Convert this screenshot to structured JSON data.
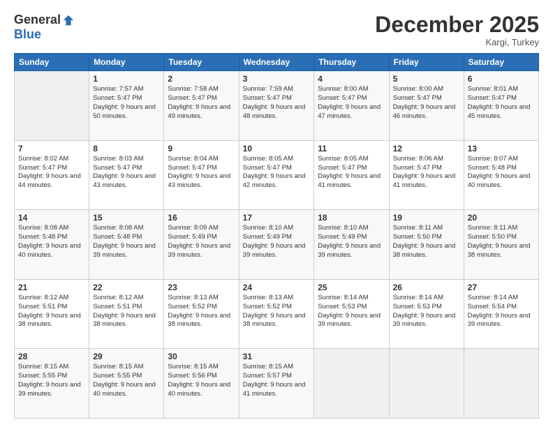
{
  "logo": {
    "general": "General",
    "blue": "Blue"
  },
  "header": {
    "month": "December 2025",
    "location": "Kargi, Turkey"
  },
  "weekdays": [
    "Sunday",
    "Monday",
    "Tuesday",
    "Wednesday",
    "Thursday",
    "Friday",
    "Saturday"
  ],
  "weeks": [
    [
      {
        "day": "",
        "sunrise": "",
        "sunset": "",
        "daylight": ""
      },
      {
        "day": "1",
        "sunrise": "Sunrise: 7:57 AM",
        "sunset": "Sunset: 5:47 PM",
        "daylight": "Daylight: 9 hours and 50 minutes."
      },
      {
        "day": "2",
        "sunrise": "Sunrise: 7:58 AM",
        "sunset": "Sunset: 5:47 PM",
        "daylight": "Daylight: 9 hours and 49 minutes."
      },
      {
        "day": "3",
        "sunrise": "Sunrise: 7:59 AM",
        "sunset": "Sunset: 5:47 PM",
        "daylight": "Daylight: 9 hours and 48 minutes."
      },
      {
        "day": "4",
        "sunrise": "Sunrise: 8:00 AM",
        "sunset": "Sunset: 5:47 PM",
        "daylight": "Daylight: 9 hours and 47 minutes."
      },
      {
        "day": "5",
        "sunrise": "Sunrise: 8:00 AM",
        "sunset": "Sunset: 5:47 PM",
        "daylight": "Daylight: 9 hours and 46 minutes."
      },
      {
        "day": "6",
        "sunrise": "Sunrise: 8:01 AM",
        "sunset": "Sunset: 5:47 PM",
        "daylight": "Daylight: 9 hours and 45 minutes."
      }
    ],
    [
      {
        "day": "7",
        "sunrise": "Sunrise: 8:02 AM",
        "sunset": "Sunset: 5:47 PM",
        "daylight": "Daylight: 9 hours and 44 minutes."
      },
      {
        "day": "8",
        "sunrise": "Sunrise: 8:03 AM",
        "sunset": "Sunset: 5:47 PM",
        "daylight": "Daylight: 9 hours and 43 minutes."
      },
      {
        "day": "9",
        "sunrise": "Sunrise: 8:04 AM",
        "sunset": "Sunset: 5:47 PM",
        "daylight": "Daylight: 9 hours and 43 minutes."
      },
      {
        "day": "10",
        "sunrise": "Sunrise: 8:05 AM",
        "sunset": "Sunset: 5:47 PM",
        "daylight": "Daylight: 9 hours and 42 minutes."
      },
      {
        "day": "11",
        "sunrise": "Sunrise: 8:05 AM",
        "sunset": "Sunset: 5:47 PM",
        "daylight": "Daylight: 9 hours and 41 minutes."
      },
      {
        "day": "12",
        "sunrise": "Sunrise: 8:06 AM",
        "sunset": "Sunset: 5:47 PM",
        "daylight": "Daylight: 9 hours and 41 minutes."
      },
      {
        "day": "13",
        "sunrise": "Sunrise: 8:07 AM",
        "sunset": "Sunset: 5:48 PM",
        "daylight": "Daylight: 9 hours and 40 minutes."
      }
    ],
    [
      {
        "day": "14",
        "sunrise": "Sunrise: 8:08 AM",
        "sunset": "Sunset: 5:48 PM",
        "daylight": "Daylight: 9 hours and 40 minutes."
      },
      {
        "day": "15",
        "sunrise": "Sunrise: 8:08 AM",
        "sunset": "Sunset: 5:48 PM",
        "daylight": "Daylight: 9 hours and 39 minutes."
      },
      {
        "day": "16",
        "sunrise": "Sunrise: 8:09 AM",
        "sunset": "Sunset: 5:49 PM",
        "daylight": "Daylight: 9 hours and 39 minutes."
      },
      {
        "day": "17",
        "sunrise": "Sunrise: 8:10 AM",
        "sunset": "Sunset: 5:49 PM",
        "daylight": "Daylight: 9 hours and 39 minutes."
      },
      {
        "day": "18",
        "sunrise": "Sunrise: 8:10 AM",
        "sunset": "Sunset: 5:49 PM",
        "daylight": "Daylight: 9 hours and 39 minutes."
      },
      {
        "day": "19",
        "sunrise": "Sunrise: 8:11 AM",
        "sunset": "Sunset: 5:50 PM",
        "daylight": "Daylight: 9 hours and 38 minutes."
      },
      {
        "day": "20",
        "sunrise": "Sunrise: 8:11 AM",
        "sunset": "Sunset: 5:50 PM",
        "daylight": "Daylight: 9 hours and 38 minutes."
      }
    ],
    [
      {
        "day": "21",
        "sunrise": "Sunrise: 8:12 AM",
        "sunset": "Sunset: 5:51 PM",
        "daylight": "Daylight: 9 hours and 38 minutes."
      },
      {
        "day": "22",
        "sunrise": "Sunrise: 8:12 AM",
        "sunset": "Sunset: 5:51 PM",
        "daylight": "Daylight: 9 hours and 38 minutes."
      },
      {
        "day": "23",
        "sunrise": "Sunrise: 8:13 AM",
        "sunset": "Sunset: 5:52 PM",
        "daylight": "Daylight: 9 hours and 38 minutes."
      },
      {
        "day": "24",
        "sunrise": "Sunrise: 8:13 AM",
        "sunset": "Sunset: 5:52 PM",
        "daylight": "Daylight: 9 hours and 38 minutes."
      },
      {
        "day": "25",
        "sunrise": "Sunrise: 8:14 AM",
        "sunset": "Sunset: 5:53 PM",
        "daylight": "Daylight: 9 hours and 39 minutes."
      },
      {
        "day": "26",
        "sunrise": "Sunrise: 8:14 AM",
        "sunset": "Sunset: 5:53 PM",
        "daylight": "Daylight: 9 hours and 39 minutes."
      },
      {
        "day": "27",
        "sunrise": "Sunrise: 8:14 AM",
        "sunset": "Sunset: 5:54 PM",
        "daylight": "Daylight: 9 hours and 39 minutes."
      }
    ],
    [
      {
        "day": "28",
        "sunrise": "Sunrise: 8:15 AM",
        "sunset": "Sunset: 5:55 PM",
        "daylight": "Daylight: 9 hours and 39 minutes."
      },
      {
        "day": "29",
        "sunrise": "Sunrise: 8:15 AM",
        "sunset": "Sunset: 5:55 PM",
        "daylight": "Daylight: 9 hours and 40 minutes."
      },
      {
        "day": "30",
        "sunrise": "Sunrise: 8:15 AM",
        "sunset": "Sunset: 5:56 PM",
        "daylight": "Daylight: 9 hours and 40 minutes."
      },
      {
        "day": "31",
        "sunrise": "Sunrise: 8:15 AM",
        "sunset": "Sunset: 5:57 PM",
        "daylight": "Daylight: 9 hours and 41 minutes."
      },
      {
        "day": "",
        "sunrise": "",
        "sunset": "",
        "daylight": ""
      },
      {
        "day": "",
        "sunrise": "",
        "sunset": "",
        "daylight": ""
      },
      {
        "day": "",
        "sunrise": "",
        "sunset": "",
        "daylight": ""
      }
    ]
  ]
}
